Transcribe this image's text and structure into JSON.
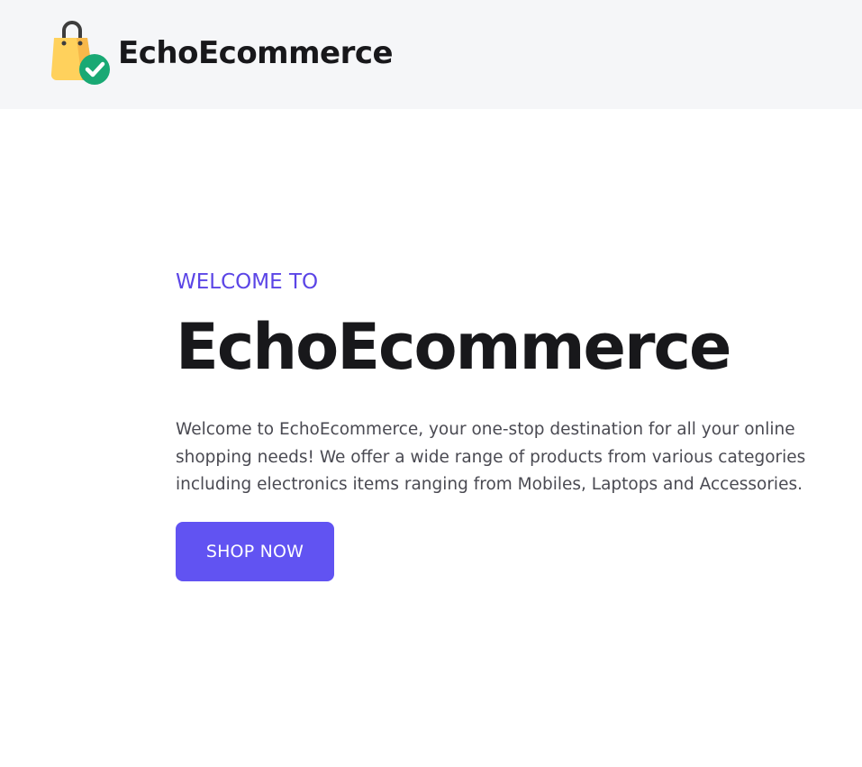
{
  "header": {
    "brand_name": "EchoEcommerce",
    "logo_icon": "shopping-bag-check-icon",
    "background": "#f5f6f8"
  },
  "hero": {
    "eyebrow": "WELCOME TO",
    "title": "EchoEcommerce",
    "description": "Welcome to EchoEcommerce, your one-stop destination for all your online shopping needs! We offer a wide range of products from various categories including electronics items ranging from Mobiles, Laptops and Accessories.",
    "cta_label": "SHOP NOW"
  },
  "colors": {
    "accent": "#6153f2",
    "eyebrow": "#5b45e6",
    "title": "#18181b",
    "body_text": "#4a4a52",
    "bag_yellow": "#ffd15c",
    "bag_orange": "#f7b84a",
    "check_green": "#19a974"
  }
}
